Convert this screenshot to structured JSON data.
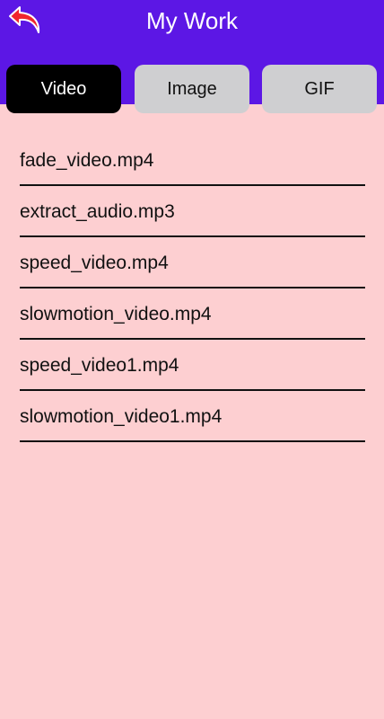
{
  "header": {
    "title": "My Work",
    "back_icon": "back-arrow-icon",
    "background_color": "#5c17e5"
  },
  "tabs": [
    {
      "label": "Video",
      "active": true
    },
    {
      "label": "Image",
      "active": false
    },
    {
      "label": "GIF",
      "active": false
    }
  ],
  "files": [
    "fade_video.mp4",
    "extract_audio.mp3",
    "speed_video.mp4",
    "slowmotion_video.mp4",
    "speed_video1.mp4",
    "slowmotion_video1.mp4"
  ],
  "colors": {
    "page_background": "#fdcfd1",
    "tab_active": "#000000",
    "tab_inactive": "#cfcfd1",
    "back_arrow": "#f0262e"
  }
}
